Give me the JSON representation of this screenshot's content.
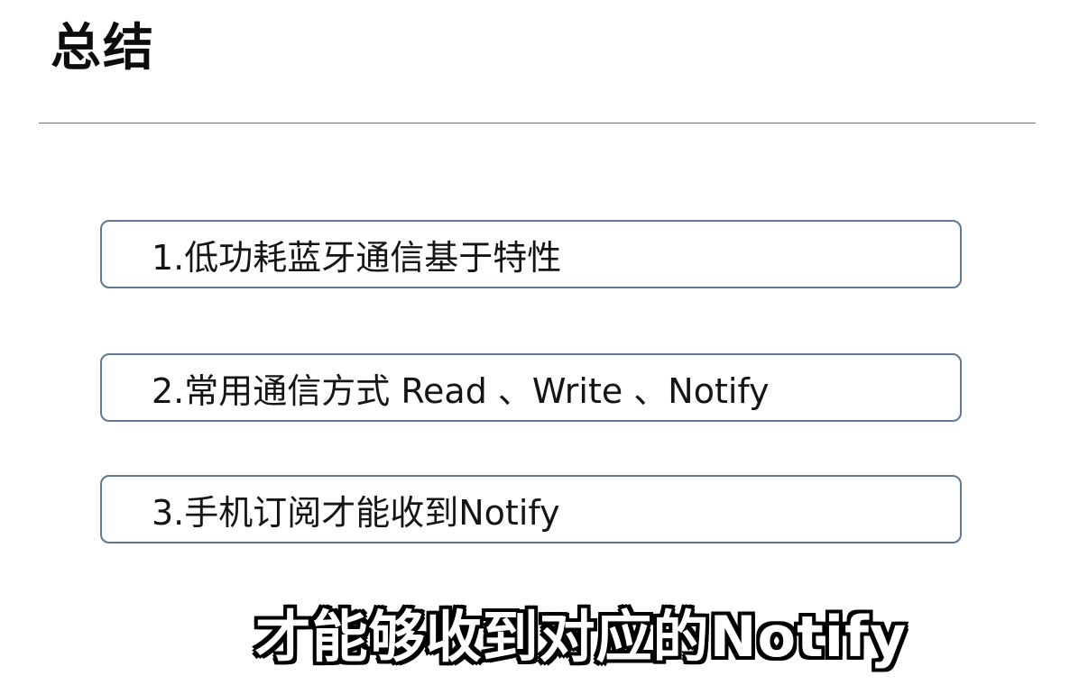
{
  "slide": {
    "title": "总结",
    "items": [
      "1.低功耗蓝牙通信基于特性",
      "2.常用通信方式 Read 、Write 、Notify",
      "3.手机订阅才能收到Notify"
    ]
  },
  "subtitle": "才能够收到对应的Notify",
  "colors": {
    "background": "#ffffff",
    "title_text": "#0d0d0d",
    "divider": "#6f6f6f",
    "item_border": "#5f7894",
    "item_text": "#151515",
    "subtitle_fill": "#ffffff",
    "subtitle_outline": "#000000"
  }
}
